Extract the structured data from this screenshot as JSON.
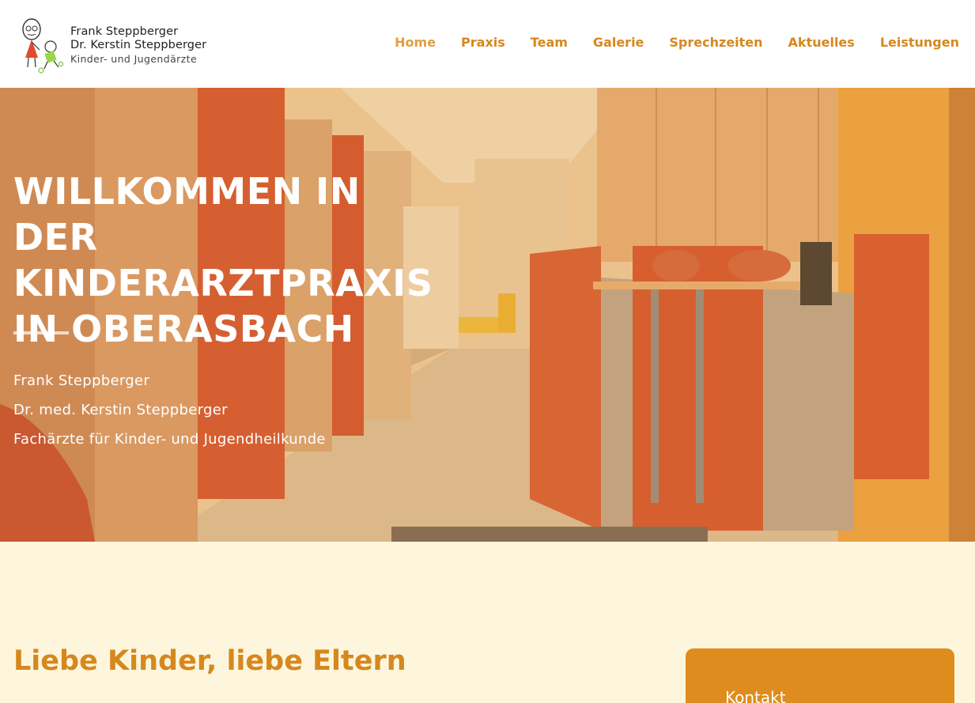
{
  "logo": {
    "line1": "Frank Steppberger",
    "line2": "Dr. Kerstin Steppberger",
    "line3": "Kinder- und Jugendärzte",
    "icon": "children-drawing-logo"
  },
  "nav": {
    "items": [
      {
        "label": "Home",
        "active": true
      },
      {
        "label": "Praxis",
        "active": false
      },
      {
        "label": "Team",
        "active": false
      },
      {
        "label": "Galerie",
        "active": false
      },
      {
        "label": "Sprechzeiten",
        "active": false
      },
      {
        "label": "Aktuelles",
        "active": false
      },
      {
        "label": "Leistungen",
        "active": false
      }
    ]
  },
  "hero": {
    "title_lines": [
      "WILLKOMMEN IN DER",
      "KINDERARZTPRAXIS",
      "IN OBERASBACH"
    ],
    "sub_lines": [
      "Frank Steppberger",
      "Dr. med. Kerstin Steppberger",
      "Fachärzte für Kinder- und Jugendheilkunde"
    ],
    "image": "practice-reception-hallway-photo"
  },
  "content": {
    "heading": "Liebe Kinder, liebe Eltern"
  },
  "contact": {
    "label": "Kontakt"
  },
  "colors": {
    "accent": "#d6881e",
    "accent_light": "#e39d3e",
    "page_bg": "#fdf6dd",
    "card_bg": "#de8c1d"
  }
}
